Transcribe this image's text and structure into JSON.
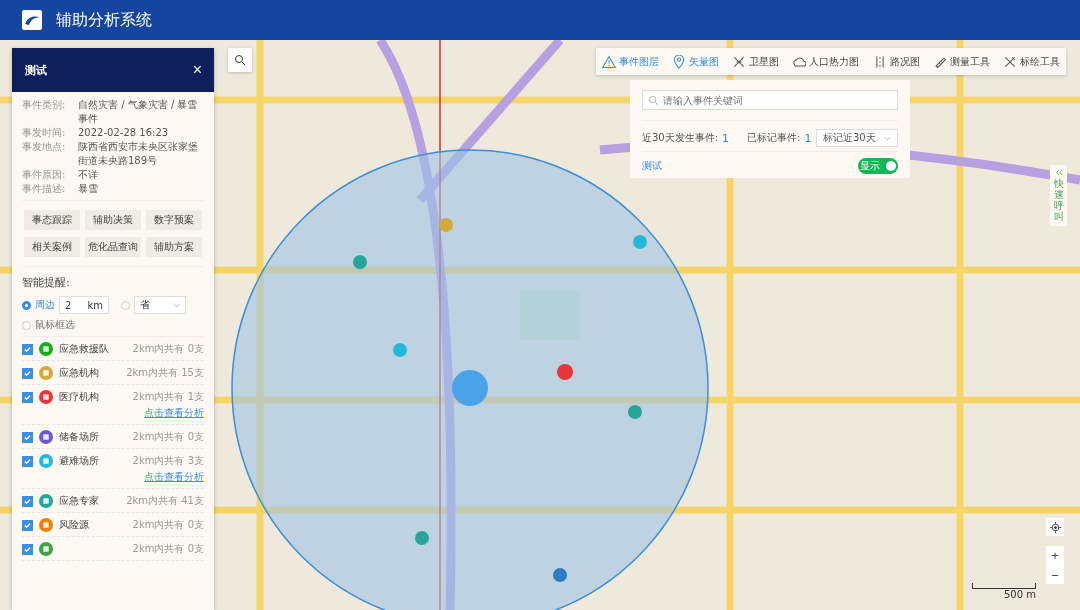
{
  "header": {
    "title": "辅助分析系统"
  },
  "panel": {
    "title": "测试",
    "close": "×",
    "details": [
      {
        "label": "事件类别:",
        "value": "自然灾害 / 气象灾害 / 暴雪事件"
      },
      {
        "label": "事发时间:",
        "value": "2022-02-28 16:23"
      },
      {
        "label": "事发地点:",
        "value": "陕西省西安市未央区张家堡街道未央路189号"
      },
      {
        "label": "事件原因:",
        "value": "不详"
      },
      {
        "label": "事件描述:",
        "value": "暴雪"
      }
    ],
    "actions": [
      "事态跟踪",
      "辅助决策",
      "数字预案",
      "相关案例",
      "危化品查询",
      "辅助方案"
    ],
    "reminder_title": "智能提醒:",
    "scope": [
      {
        "kind": "radius",
        "label": "周边",
        "value": "2",
        "unit": "km",
        "selected": true
      },
      {
        "kind": "select",
        "value": "省",
        "selected": false
      },
      {
        "kind": "plain",
        "label": "鼠标框选",
        "selected": false
      }
    ],
    "resources": [
      {
        "name": "应急救援队",
        "count": "2km内共有 0支",
        "color": "#1aad19",
        "checked": true
      },
      {
        "name": "应急机构",
        "count": "2km内共有 15支",
        "color": "#d4a93c",
        "checked": true
      },
      {
        "name": "医疗机构",
        "count": "2km内共有 1支",
        "color": "#e8343a",
        "checked": true,
        "link": "点击查看分析"
      },
      {
        "name": "储备场所",
        "count": "2km内共有 0支",
        "color": "#6a5acd",
        "checked": true
      },
      {
        "name": "避难场所",
        "count": "2km内共有 3支",
        "color": "#25b9d8",
        "checked": true,
        "link": "点击查看分析"
      },
      {
        "name": "应急专家",
        "count": "2km内共有 41支",
        "color": "#26a69a",
        "checked": true
      },
      {
        "name": "风险源",
        "count": "2km内共有 0支",
        "color": "#f57c00",
        "checked": true
      },
      {
        "count": "2km内共有 0支",
        "color": "#43a047",
        "checked": true
      }
    ]
  },
  "toolbar": [
    {
      "label": "事件图层",
      "selected": true
    },
    {
      "label": "矢量图",
      "selected": true
    },
    {
      "label": "卫星图",
      "selected": false
    },
    {
      "label": "人口热力图",
      "selected": false
    },
    {
      "label": "路况图",
      "selected": false
    },
    {
      "label": "测量工具",
      "selected": false
    },
    {
      "label": "标绘工具",
      "selected": false
    }
  ],
  "event_panel": {
    "search": {
      "placeholder": "请输入事件关键词"
    },
    "recent_label": "近30天发生事件:",
    "recent_count": "1",
    "marked_label": "已标记事件:",
    "marked_count": "1",
    "filter": "标记近30天",
    "layer": "测试",
    "toggle": {
      "label": "显示",
      "on": true
    }
  },
  "quick_call": "快速呼叫",
  "zoom": {
    "in": "+",
    "out": "−"
  },
  "scale": "500 m"
}
